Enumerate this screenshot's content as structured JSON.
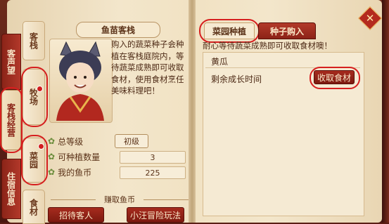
{
  "window": {
    "close_icon": "close-icon"
  },
  "outer_tabs": [
    {
      "label": "客声望",
      "active": false
    },
    {
      "label": "客栈经营",
      "active": true
    },
    {
      "label": "住宿信息",
      "active": false
    }
  ],
  "inner_tabs": [
    {
      "label": "客栈"
    },
    {
      "label": "牧场"
    },
    {
      "label": "菜园"
    },
    {
      "label": "食材"
    }
  ],
  "left_page": {
    "title": "鱼苗客栈",
    "description": "购入的蔬菜种子会种植在客栈庭院内，等待蔬菜成熟即可收取食材，使用食材烹任美味料理吧！",
    "stats": [
      {
        "label": "总等级",
        "value": "初级",
        "icon": "flower-icon"
      },
      {
        "label": "可种植数量",
        "value": "3",
        "icon": "flower-icon"
      },
      {
        "label": "我的鱼币",
        "value": "225",
        "icon": "flower-icon"
      }
    ],
    "earn_title": "赚取鱼币",
    "earn_buttons": [
      "招待客人",
      "小汪冒险玩法"
    ]
  },
  "right_page": {
    "tabs": [
      "菜园种植",
      "种子购入"
    ],
    "hint": "耐心等待蔬菜成熟即可收取食材噢！",
    "crop": {
      "name": "黄瓜",
      "remain_label": "剩余成长时间",
      "harvest_label": "收取食材"
    }
  },
  "colors": {
    "accent_red": "#d61f1f",
    "button_red": "#8c2217",
    "parchment": "#f3e6cb"
  }
}
